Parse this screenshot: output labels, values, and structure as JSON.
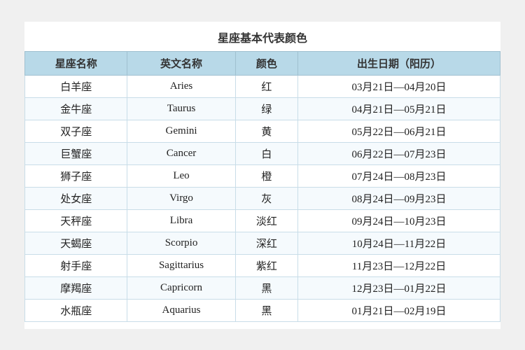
{
  "title": "星座基本代表颜色",
  "headers": [
    "星座名称",
    "英文名称",
    "颜色",
    "出生日期（阳历）"
  ],
  "rows": [
    {
      "chinese": "白羊座",
      "english": "Aries",
      "color": "红",
      "dates": "03月21日—04月20日"
    },
    {
      "chinese": "金牛座",
      "english": "Taurus",
      "color": "绿",
      "dates": "04月21日—05月21日"
    },
    {
      "chinese": "双子座",
      "english": "Gemini",
      "color": "黄",
      "dates": "05月22日—06月21日"
    },
    {
      "chinese": "巨蟹座",
      "english": "Cancer",
      "color": "白",
      "dates": "06月22日—07月23日"
    },
    {
      "chinese": "狮子座",
      "english": "Leo",
      "color": "橙",
      "dates": "07月24日—08月23日"
    },
    {
      "chinese": "处女座",
      "english": "Virgo",
      "color": "灰",
      "dates": "08月24日—09月23日"
    },
    {
      "chinese": "天秤座",
      "english": "Libra",
      "color": "淡红",
      "dates": "09月24日—10月23日"
    },
    {
      "chinese": "天蝎座",
      "english": "Scorpio",
      "color": "深红",
      "dates": "10月24日—11月22日"
    },
    {
      "chinese": "射手座",
      "english": "Sagittarius",
      "color": "紫红",
      "dates": "11月23日—12月22日"
    },
    {
      "chinese": "摩羯座",
      "english": "Capricorn",
      "color": "黑",
      "dates": "12月23日—01月22日"
    },
    {
      "chinese": "水瓶座",
      "english": "Aquarius",
      "color": "黑",
      "dates": "01月21日—02月19日"
    }
  ]
}
